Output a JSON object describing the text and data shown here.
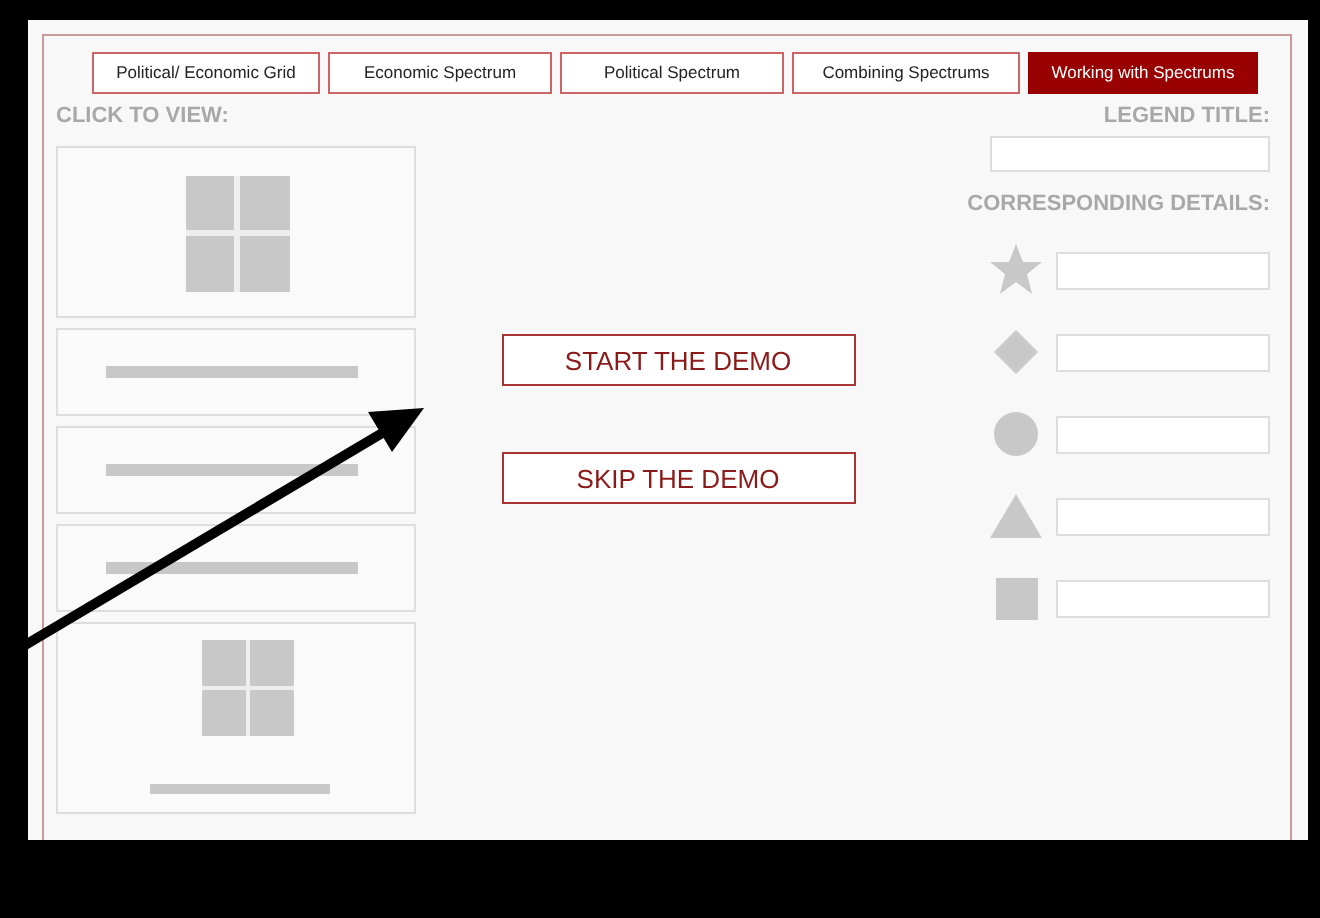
{
  "tabs": [
    {
      "label": "Political/ Economic Grid",
      "selected": false
    },
    {
      "label": "Economic Spectrum",
      "selected": false
    },
    {
      "label": "Political Spectrum",
      "selected": false
    },
    {
      "label": "Combining Spectrums",
      "selected": false
    },
    {
      "label": "Working with Spectrums",
      "selected": true
    }
  ],
  "left_panel": {
    "heading": "CLICK TO VIEW:",
    "thumbnails": [
      {
        "kind": "grid"
      },
      {
        "kind": "spectrum"
      },
      {
        "kind": "spectrum"
      },
      {
        "kind": "spectrum"
      },
      {
        "kind": "combined"
      }
    ]
  },
  "buttons": [
    "START THE DEMO",
    "SKIP THE DEMO"
  ],
  "legend": {
    "title_label": "LEGEND TITLE:",
    "details_label": "CORRESPONDING DETAILS:",
    "rows": [
      {
        "kind": "star"
      },
      {
        "kind": "diamond"
      },
      {
        "kind": "circle"
      },
      {
        "kind": "triangle"
      },
      {
        "kind": "square"
      }
    ]
  }
}
